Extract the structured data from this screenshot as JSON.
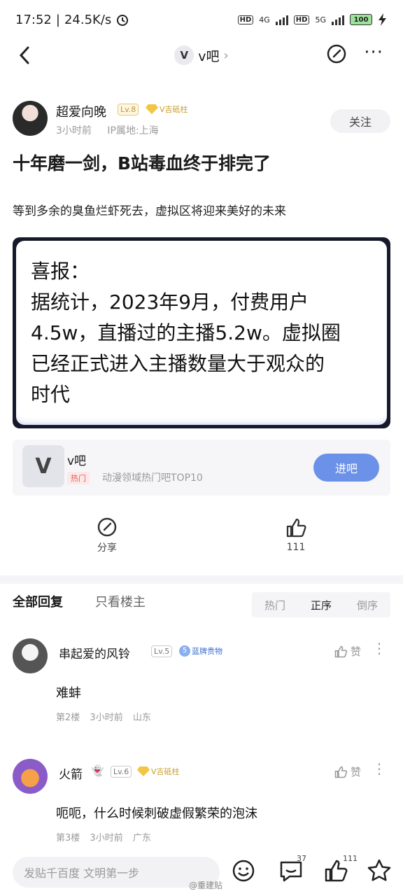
{
  "status_bar": {
    "time": "17:52",
    "speed": "24.5K/s",
    "hd1": "HD",
    "net1": "4G",
    "hd2": "HD",
    "net2": "5G",
    "battery": "100"
  },
  "nav": {
    "bar_name": "v吧"
  },
  "post": {
    "author": "超爱向晚",
    "level": "Lv.8",
    "badge": "V吉砥柱",
    "time": "3小时前",
    "ip": "IP属地:上海",
    "follow_label": "关注",
    "title": "十年磨一剑，B站毒血终于排完了",
    "body": "等到多余的臭鱼烂虾死去，虚拟区将迎来美好的未来",
    "quote_lines": [
      "喜报：",
      "据统计，2023年9月，付费用户",
      "4.5w，直播过的主播5.2w。虚拟圈",
      "已经正式进入主播数量大于观众的",
      "时代"
    ]
  },
  "forum": {
    "name": "v吧",
    "tag": "热门",
    "desc": "动漫领域热门吧TOP10",
    "enter_label": "进吧"
  },
  "actions": {
    "share_label": "分享",
    "like_count": "111"
  },
  "reply_tabs": {
    "all": "全部回复",
    "op_only": "只看楼主",
    "sort": [
      "热门",
      "正序",
      "倒序"
    ]
  },
  "comments": [
    {
      "name": "串起爱的风铃",
      "level": "Lv.5",
      "badge": "蓝牌贵物",
      "like_label": "赞",
      "text": "难蚌",
      "floor": "第2楼",
      "time": "3小时前",
      "location": "山东"
    },
    {
      "name": "火箭",
      "level": "Lv.6",
      "badge": "V吉砥柱",
      "like_label": "赞",
      "text": "呃呃，什么时候刺破虚假繁荣的泡沫",
      "floor": "第3楼",
      "time": "3小时前",
      "location": "广东"
    }
  ],
  "bottom": {
    "input_placeholder": "发贴千百度 文明第一步",
    "comment_count": "37",
    "like_count": "111",
    "watermark": "@重建贴"
  },
  "colors": {
    "accent": "#6b92e8",
    "gold": "#c89d2b"
  }
}
